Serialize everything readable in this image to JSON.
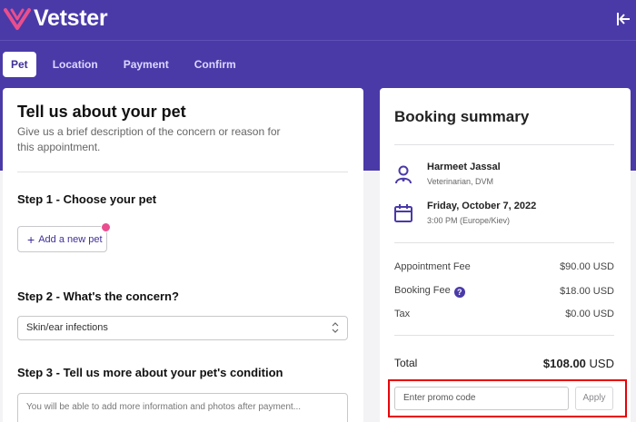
{
  "brand": {
    "name": "Vetster"
  },
  "tabs": [
    {
      "label": "Pet",
      "active": true
    },
    {
      "label": "Location",
      "active": false
    },
    {
      "label": "Payment",
      "active": false
    },
    {
      "label": "Confirm",
      "active": false
    }
  ],
  "form": {
    "title": "Tell us about your pet",
    "subtitle": "Give us a brief description of the concern or reason for this appointment.",
    "step1": {
      "title": "Step 1 - Choose your pet",
      "add_pet_label": "Add a new pet"
    },
    "step2": {
      "title": "Step 2 - What's the concern?",
      "selected_concern": "Skin/ear infections"
    },
    "step3": {
      "title": "Step 3 - Tell us more about your pet's condition",
      "placeholder": "You will be able to add more information and photos after payment..."
    }
  },
  "summary": {
    "title": "Booking summary",
    "vet": {
      "name": "Harmeet Jassal",
      "role": "Veterinarian, DVM",
      "icon": "vet-icon"
    },
    "date": {
      "day": "Friday, October 7, 2022",
      "time": "3:00 PM (Europe/Kiev)",
      "icon": "calendar-icon"
    },
    "fees": [
      {
        "label": "Appointment Fee",
        "value": "$90.00 USD"
      },
      {
        "label": "Booking Fee",
        "value": "$18.00 USD"
      },
      {
        "label": "Tax",
        "value": "$0.00 USD"
      }
    ],
    "total": {
      "label": "Total",
      "amount": "$108.00",
      "currency": "USD"
    },
    "promo": {
      "placeholder": "Enter promo code",
      "apply_label": "Apply"
    }
  },
  "colors": {
    "brand": "#4a3aa8",
    "accent_pink": "#ea4e8f",
    "highlight": "#e8000b"
  }
}
